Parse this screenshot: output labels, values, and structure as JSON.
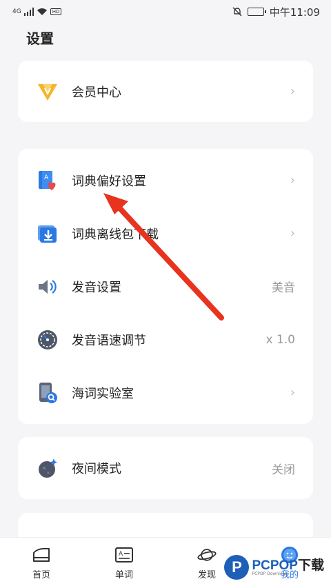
{
  "status": {
    "network": "4G",
    "badge": "HD",
    "time": "中午11:09"
  },
  "page": {
    "title": "设置"
  },
  "vip": {
    "label": "会员中心"
  },
  "settings": [
    {
      "label": "词典偏好设置",
      "value": "",
      "chevron": "›"
    },
    {
      "label": "词典离线包下载",
      "value": "",
      "chevron": "›"
    },
    {
      "label": "发音设置",
      "value": "美音",
      "chevron": ""
    },
    {
      "label": "发音语速调节",
      "value": "x 1.0",
      "chevron": ""
    },
    {
      "label": "海词实验室",
      "value": "",
      "chevron": "›"
    }
  ],
  "night": {
    "label": "夜间模式",
    "value": "关闭"
  },
  "tabs": [
    {
      "label": "首页",
      "icon": "home-icon"
    },
    {
      "label": "单词",
      "icon": "word-card-icon"
    },
    {
      "label": "发现",
      "icon": "planet-icon"
    },
    {
      "label": "我的",
      "icon": "profile-icon"
    }
  ],
  "watermark": {
    "logo_letter": "P",
    "brand": "PCPOP",
    "suffix": "下载",
    "sub": "PCPOP Download"
  },
  "colors": {
    "accent": "#2b78e4",
    "arrow": "#e8331f",
    "vip_gold": "#f3b52a"
  }
}
